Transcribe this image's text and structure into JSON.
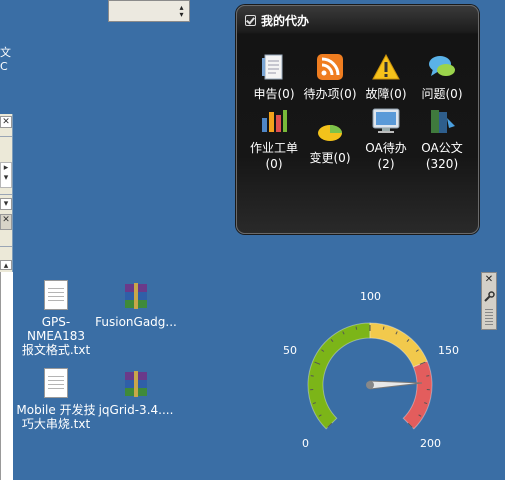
{
  "edge": {
    "line1": "文",
    "line2": "C"
  },
  "widget": {
    "title": "我的代办",
    "tiles": [
      {
        "label": "申告(0)",
        "icon": "document-icon"
      },
      {
        "label": "待办项(0)",
        "icon": "rss-icon"
      },
      {
        "label": "故障(0)",
        "icon": "warning-icon"
      },
      {
        "label": "问题(0)",
        "icon": "chat-icon"
      },
      {
        "label": "作业工单",
        "label2": "(0)",
        "icon": "bar-chart-icon"
      },
      {
        "label": "变更(0)",
        "icon": "pie-chart-icon"
      },
      {
        "label": "OA待办",
        "label2": "(2)",
        "icon": "monitor-icon"
      },
      {
        "label": "OA公文",
        "label2": "(320)",
        "icon": "books-icon"
      }
    ]
  },
  "gauge": {
    "ticks": [
      "0",
      "50",
      "100",
      "150",
      "200"
    ],
    "min": 0,
    "max": 200,
    "value": 165,
    "colors": {
      "low": "#7cb518",
      "mid": "#f2c94c",
      "high": "#e35d5d"
    }
  },
  "desktop": {
    "items": [
      {
        "line1": "GPS-NMEA183",
        "line2": "报文格式.txt",
        "type": "text-file"
      },
      {
        "line1": "FusionGadg...",
        "line2": "",
        "type": "rar-archive"
      },
      {
        "line1": "Mobile 开发技",
        "line2": "巧大串烧.txt",
        "type": "text-file"
      },
      {
        "line1": "jqGrid-3.4....",
        "line2": "",
        "type": "rar-archive"
      }
    ]
  }
}
